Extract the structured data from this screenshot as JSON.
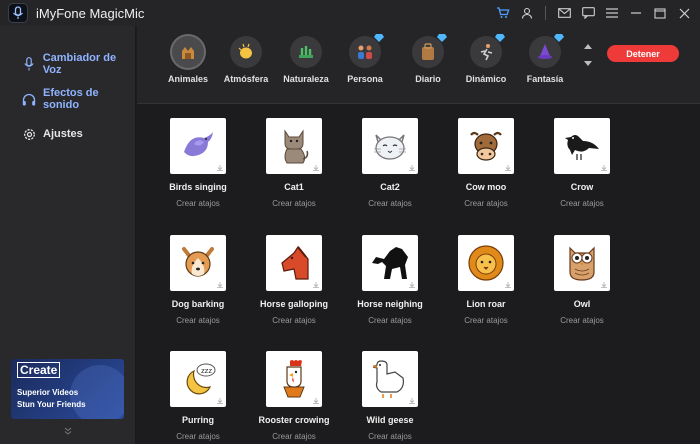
{
  "window": {
    "title": "iMyFone MagicMic"
  },
  "sidebar": {
    "items": [
      {
        "label": "Cambiador de Voz",
        "icon": "microphone-icon"
      },
      {
        "label": "Efectos de sonido",
        "icon": "headphones-icon"
      },
      {
        "label": "Ajustes",
        "icon": "gear-icon"
      }
    ],
    "promo": {
      "title": "Create",
      "line1": "Superior Videos",
      "line2": "Stun Your Friends"
    }
  },
  "categories": [
    {
      "label": "Animales",
      "icon": "animals-icon",
      "premium": false
    },
    {
      "label": "Atmósfera",
      "icon": "clap-icon",
      "premium": false
    },
    {
      "label": "Naturaleza",
      "icon": "nature-icon",
      "premium": false
    },
    {
      "label": "Persona",
      "icon": "people-icon",
      "premium": true
    },
    {
      "label": "Diario",
      "icon": "bag-icon",
      "premium": true
    },
    {
      "label": "Dinámico",
      "icon": "running-icon",
      "premium": true
    },
    {
      "label": "Fantasía",
      "icon": "wizard-icon",
      "premium": true
    }
  ],
  "stop_button": "Detener",
  "sounds": [
    {
      "name": "Birds singing",
      "shortcut": "Crear atajos",
      "icon": "bird-icon"
    },
    {
      "name": "Cat1",
      "shortcut": "Crear atajos",
      "icon": "cat-icon"
    },
    {
      "name": "Cat2",
      "shortcut": "Crear atajos",
      "icon": "cat-face-icon"
    },
    {
      "name": "Cow moo",
      "shortcut": "Crear atajos",
      "icon": "cow-icon"
    },
    {
      "name": "Crow",
      "shortcut": "Crear atajos",
      "icon": "crow-icon"
    },
    {
      "name": "Dog barking",
      "shortcut": "Crear atajos",
      "icon": "dog-icon"
    },
    {
      "name": "Horse galloping",
      "shortcut": "Crear atajos",
      "icon": "horse-head-icon"
    },
    {
      "name": "Horse neighing",
      "shortcut": "Crear atajos",
      "icon": "horse-silhouette-icon"
    },
    {
      "name": "Lion roar",
      "shortcut": "Crear atajos",
      "icon": "lion-icon"
    },
    {
      "name": "Owl",
      "shortcut": "Crear atajos",
      "icon": "owl-icon"
    },
    {
      "name": "Purring",
      "shortcut": "Crear atajos",
      "icon": "moon-sleep-icon"
    },
    {
      "name": "Rooster crowing",
      "shortcut": "Crear atajos",
      "icon": "rooster-icon"
    },
    {
      "name": "Wild geese",
      "shortcut": "Crear atajos",
      "icon": "goose-icon"
    }
  ],
  "colors": {
    "accent": "#8fb3ff",
    "stop": "#ef3a3a",
    "premium": "#4fb7ff"
  }
}
